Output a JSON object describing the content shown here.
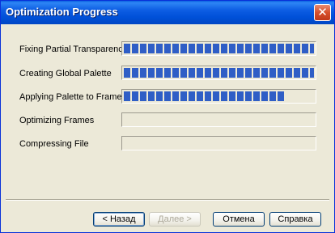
{
  "window": {
    "title": "Optimization Progress",
    "close_label": "✕"
  },
  "tasks": [
    {
      "label": "Fixing Partial Transparency",
      "progress": 1.0
    },
    {
      "label": "Creating Global Palette",
      "progress": 1.0
    },
    {
      "label": "Applying Palette to Frames",
      "progress": 0.86
    },
    {
      "label": "Optimizing Frames",
      "progress": 0.0
    },
    {
      "label": "Compressing File",
      "progress": 0.0
    }
  ],
  "buttons": {
    "back": "< Назад",
    "next": "Далее >",
    "cancel": "Отмена",
    "help": "Справка"
  },
  "colors": {
    "progress_fill": "#2f5ec6",
    "titlebar": "#0050d8"
  }
}
